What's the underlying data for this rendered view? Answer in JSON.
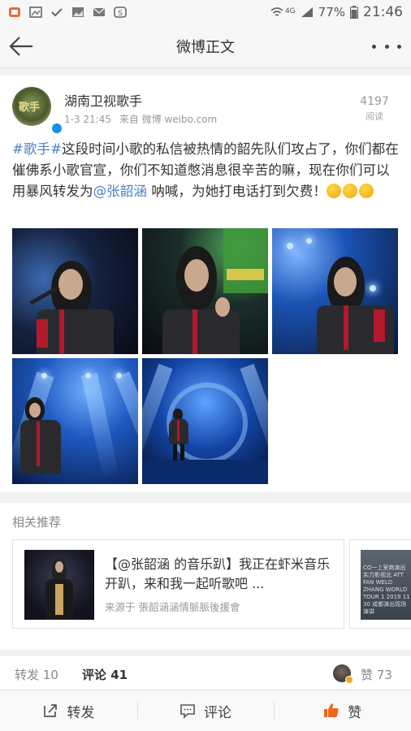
{
  "statusbar": {
    "signal_label": "4G",
    "battery": "77%",
    "time": "21:46"
  },
  "titlebar": {
    "title": "微博正文"
  },
  "post": {
    "author": "湖南卫视歌手",
    "avatar_text": "歌手",
    "time": "1-3 21:45",
    "source_prefix": "来自",
    "source": "微博 weibo.com",
    "reads_count": "4197",
    "reads_label": "阅读",
    "text": {
      "topic": "#歌手#",
      "part1": "这段时间小歌的私信被热情的韶先队们攻占了，你们都在催佛系小歌官宣，你们不知道憋消息很辛苦的嘛，现在你们可以用暴风转发为",
      "mention": "@张韶涵",
      "part2": " 呐喊，为她打电话打到欠费！"
    },
    "photos": [
      "performance-photo-1",
      "performance-photo-2",
      "performance-photo-3",
      "performance-photo-4",
      "performance-photo-5"
    ]
  },
  "related": {
    "title": "相关推荐",
    "card": {
      "title": "【@张韶涵 的音乐趴】我正在虾米音乐开趴，来和我一起听歌吧 ...",
      "source": "来源于 張韶涵涵情脈脈後援會"
    },
    "card2_text": "CO一上室商演出实力影视北 ATT FAN WELD ZHANG WORLD TOUR 1 2019 11 30 成都演出现场演讲"
  },
  "counts": {
    "repost_label": "转发",
    "repost_count": "10",
    "comment_label": "评论",
    "comment_count": "41",
    "like_label": "赞",
    "like_count": "73"
  },
  "actions": {
    "repost": "转发",
    "comment": "评论",
    "like": "赞"
  },
  "colors": {
    "link": "#4b82c6",
    "verified": "#1a8fe3",
    "like_icon": "#f0651d"
  }
}
